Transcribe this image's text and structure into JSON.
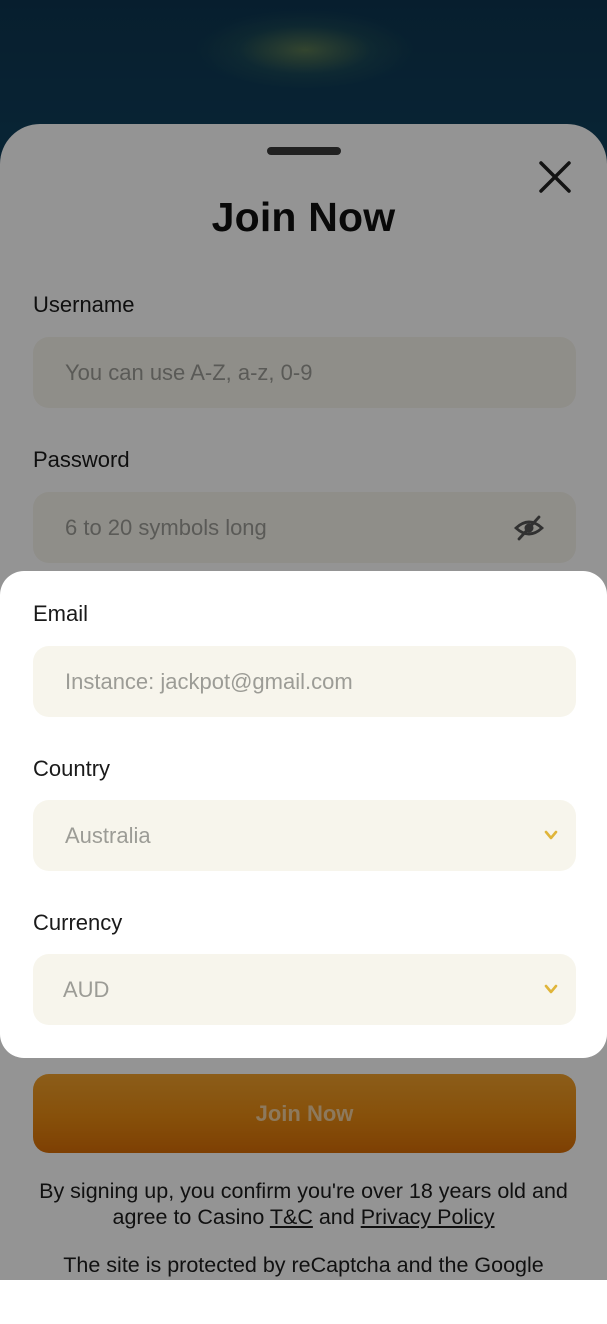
{
  "modal": {
    "title": "Join Now",
    "close_icon": "close-icon"
  },
  "username": {
    "label": "Username",
    "placeholder": "You can use A-Z, a-z, 0-9",
    "value": ""
  },
  "password": {
    "label": "Password",
    "placeholder": "6 to 20 symbols long",
    "value": "",
    "toggle_icon": "eye-off-icon"
  },
  "email": {
    "label": "Email",
    "placeholder": "Instance: jackpot@gmail.com",
    "value": ""
  },
  "country": {
    "label": "Country",
    "value": "Australia",
    "icon": "chevron-down-icon"
  },
  "currency": {
    "label": "Currency",
    "value": "AUD",
    "icon": "chevron-down-icon"
  },
  "submit": {
    "label": "Join Now"
  },
  "terms": {
    "line1": "By signing up, you confirm you're over 18 years old and",
    "line2_prefix": "agree to Casino ",
    "tc_link": "T&C",
    "and": " and ",
    "privacy_link": "Privacy Policy"
  },
  "recaptcha": {
    "text": "The site is protected by reCaptcha and the Google"
  },
  "colors": {
    "accent": "#e88a12",
    "field_bg": "#f7f5ec",
    "chevron": "#e0b53a",
    "backdrop": "#0d3550"
  }
}
